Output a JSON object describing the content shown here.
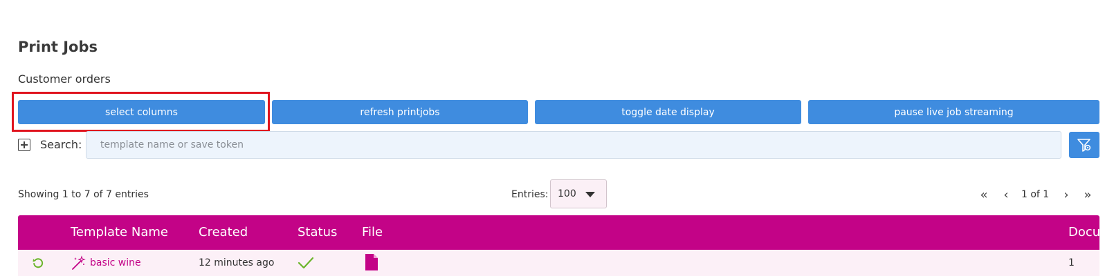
{
  "page": {
    "title": "Print Jobs",
    "subtitle": "Customer orders"
  },
  "toolbar": {
    "select_columns_label": "select columns",
    "refresh_label": "refresh printjobs",
    "toggle_date_label": "toggle date display",
    "pause_streaming_label": "pause live job streaming"
  },
  "search": {
    "label": "Search:",
    "placeholder": "template name or save token",
    "value": ""
  },
  "listing": {
    "showing_text": "Showing 1 to 7 of 7 entries",
    "entries_label": "Entries:",
    "entries_value": "100",
    "page_info": "1 of 1",
    "first_glyph": "«",
    "prev_glyph": "‹",
    "next_glyph": "›",
    "last_glyph": "»"
  },
  "table": {
    "columns": [
      "Template Name",
      "Created",
      "Status",
      "File",
      "Docu"
    ],
    "rows": [
      {
        "template_name": "basic wine",
        "created": "12 minutes ago",
        "status_icon": "checkmark-icon",
        "file_icon": "document-icon",
        "docu": "1"
      }
    ]
  },
  "colors": {
    "button_blue": "#3f8cdf",
    "header_magenta": "#c30387",
    "row_pink": "#fcf0f7",
    "status_green": "#6bb52a",
    "highlight_red": "#e0141e"
  }
}
